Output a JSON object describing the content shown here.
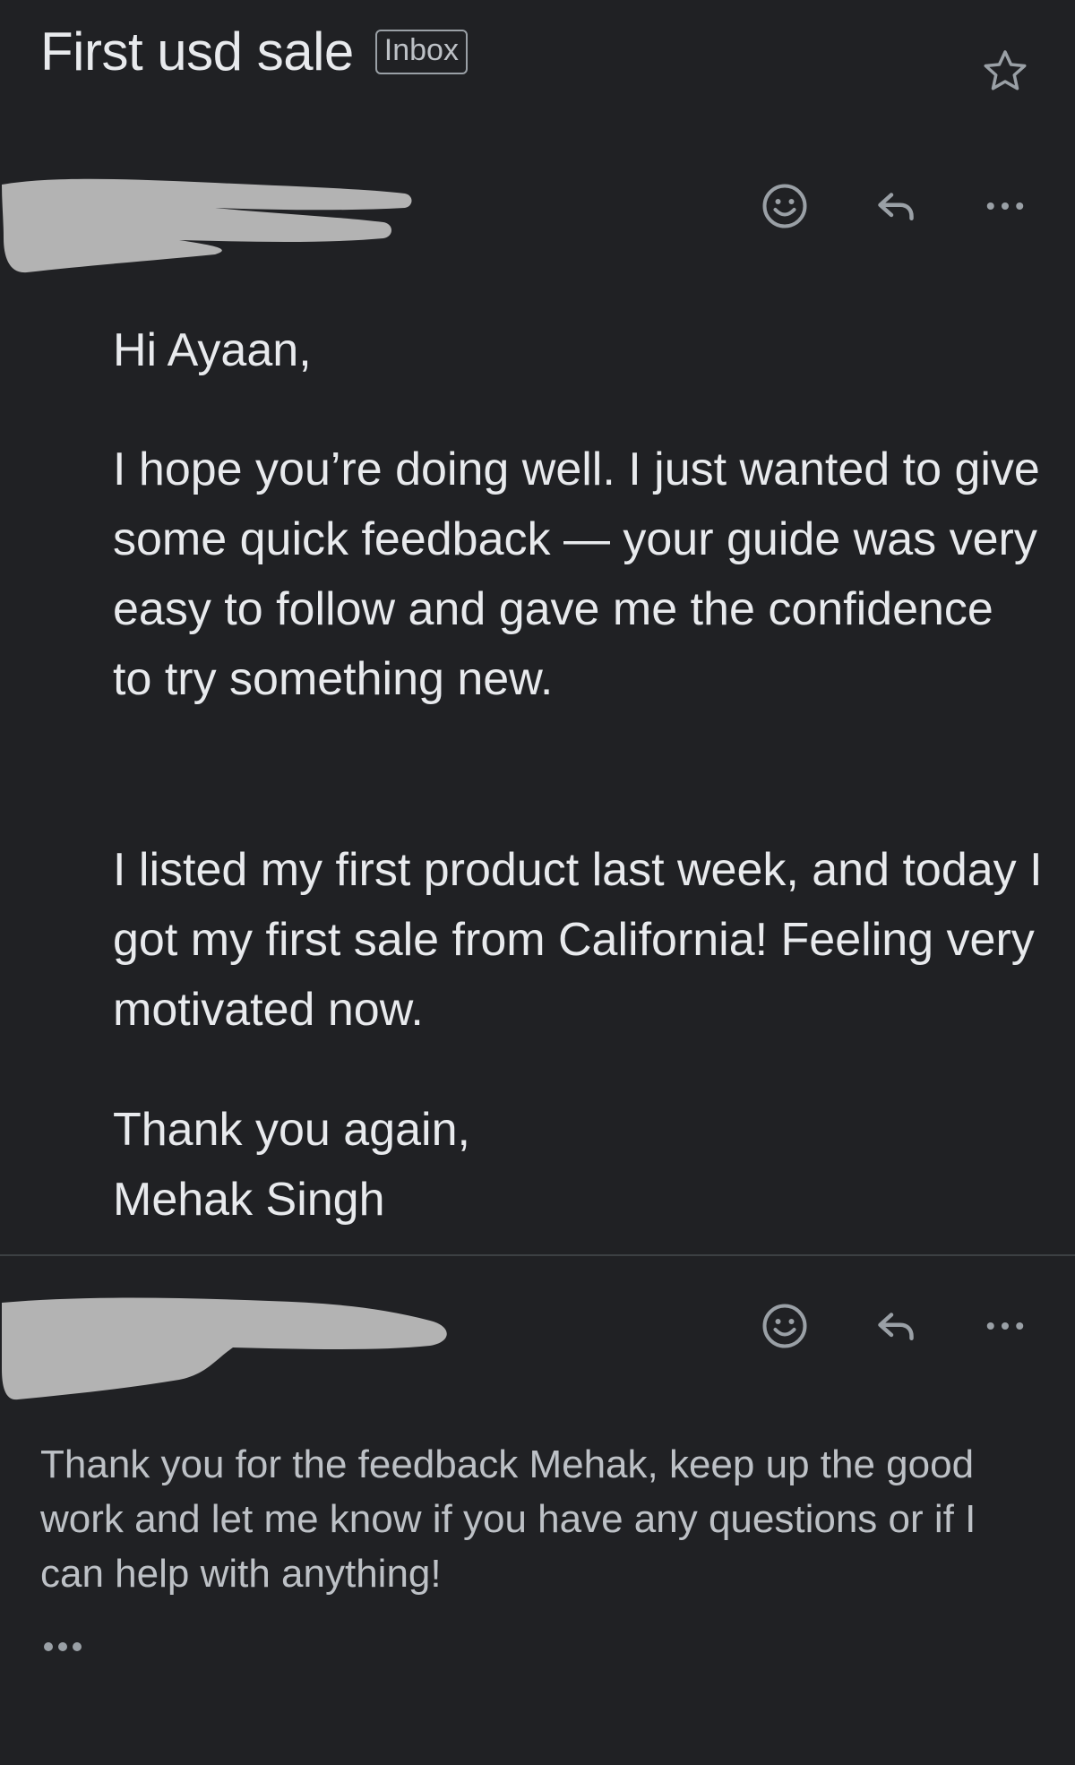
{
  "header": {
    "subject": "First usd sale",
    "label": "Inbox",
    "star_icon": "star-outline-icon"
  },
  "messages": [
    {
      "sender_redacted": true,
      "icons": [
        "smiley-icon",
        "reply-icon",
        "more-horizontal-icon"
      ],
      "greeting": "Hi Ayaan,",
      "paragraphs": [
        "I hope you’re doing well. I just wanted to give some quick feedback — your guide was very easy to follow and gave me the confidence to try something new.",
        "I listed my first product last week, and today I got my first sale from California! Feeling very motivated now."
      ],
      "signoff": "Thank you again,",
      "signature": "Mehak Singh"
    },
    {
      "sender_redacted": true,
      "icons": [
        "smiley-icon",
        "reply-icon",
        "more-horizontal-icon"
      ],
      "body": "Thank you for the feedback Mehak, keep up the good work and let me know if you have any questions or if I can help with anything!",
      "show_trimmed_icon": "ellipsis-icon"
    }
  ],
  "colors": {
    "background": "#202124",
    "text_primary": "#e8eaed",
    "text_secondary": "#bdc1c6",
    "icon": "#9aa0a6",
    "redaction": "#b3b3b3",
    "divider": "#3c4043"
  }
}
